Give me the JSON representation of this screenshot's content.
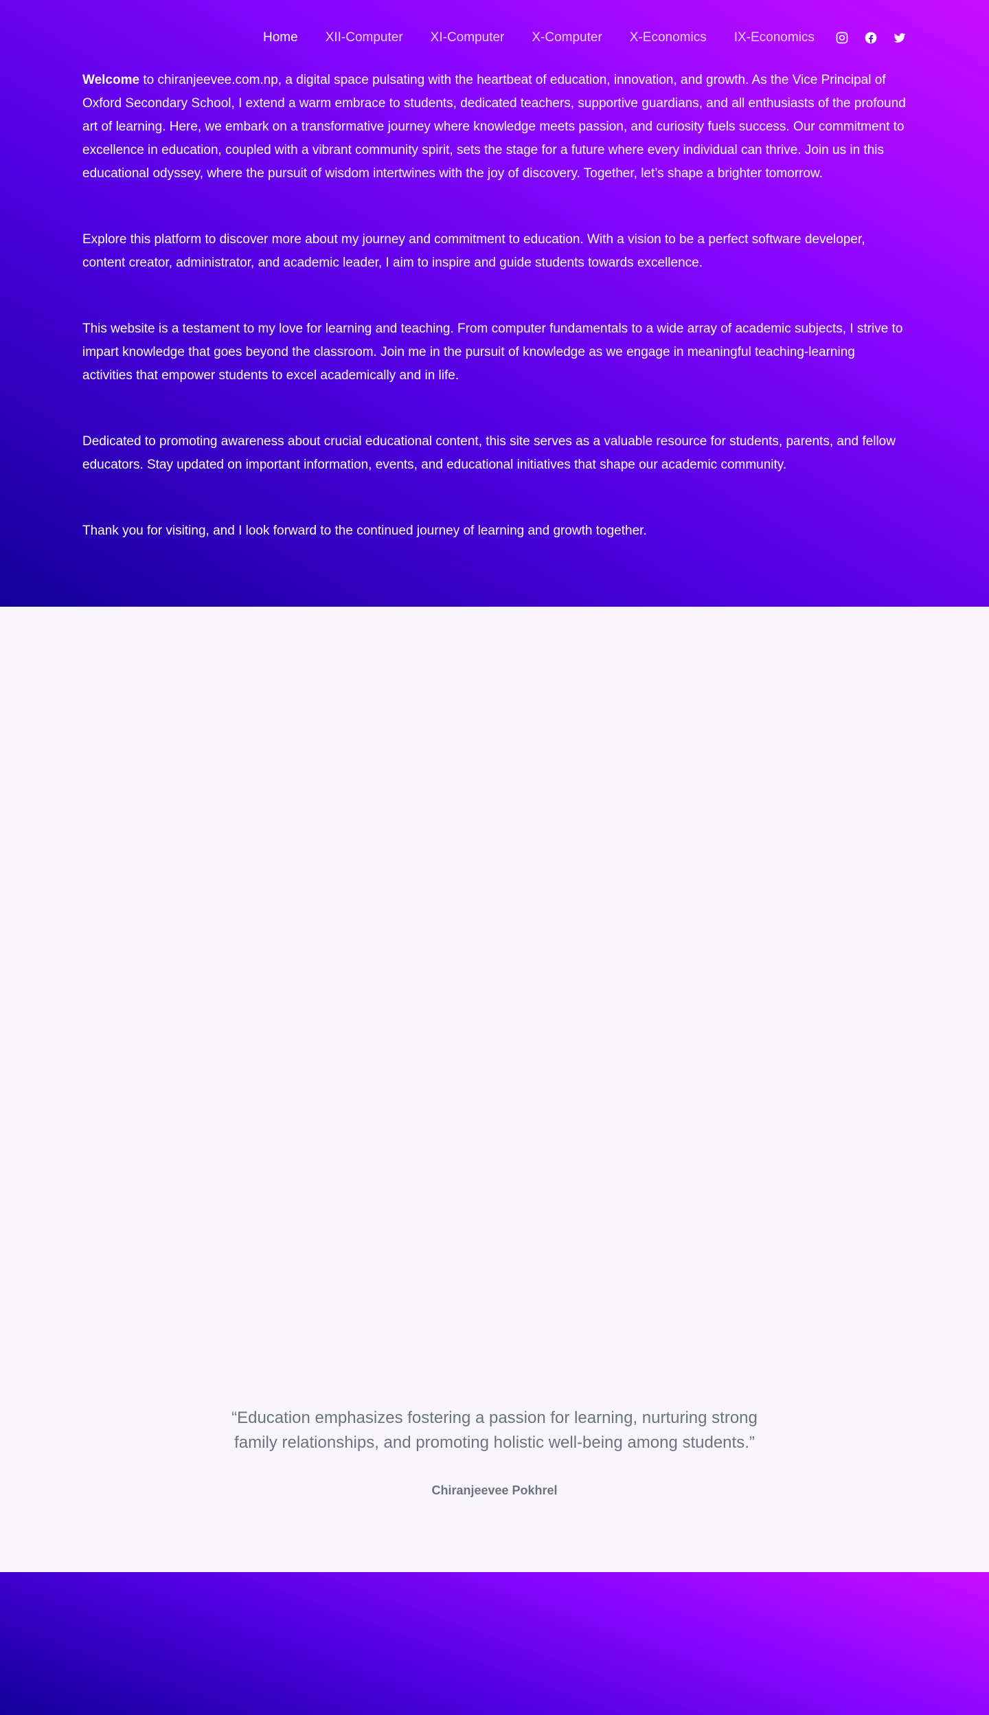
{
  "nav": {
    "items": [
      {
        "label": "Home",
        "active": true
      },
      {
        "label": "XII-Computer",
        "active": false
      },
      {
        "label": "XI-Computer",
        "active": false
      },
      {
        "label": "X-Computer",
        "active": false
      },
      {
        "label": "X-Economics",
        "active": false
      },
      {
        "label": "IX-Economics",
        "active": false
      }
    ],
    "social": [
      "instagram-icon",
      "facebook-icon",
      "twitter-icon"
    ]
  },
  "intro": {
    "welcome_bold": "Welcome",
    "p1_rest": " to chiranjeevee.com.np, a digital space pulsating with the heartbeat of education, innovation, and growth. As the Vice Principal of Oxford Secondary School, I extend a warm embrace to students, dedicated teachers, supportive guardians, and all enthusiasts of the profound art of learning. Here, we embark on a transformative journey where knowledge meets passion, and curiosity fuels success. Our commitment to excellence in education, coupled with a vibrant community spirit, sets the stage for a future where every individual can thrive. Join us in this educational odyssey, where the pursuit of wisdom intertwines with the joy of discovery. Together, let’s shape a brighter tomorrow.",
    "p2": "Explore this platform to discover more about my journey and commitment to education. With a vision to be a perfect software developer, content creator, administrator, and academic leader, I aim to inspire and guide students towards excellence.",
    "p3": "This website is a testament to my love for learning and teaching. From computer fundamentals to a wide array of academic subjects, I strive to impart knowledge that goes beyond the classroom. Join me in the pursuit of knowledge as we engage in meaningful teaching-learning activities that empower students to excel academically and in life.",
    "p4": "Dedicated to promoting awareness about crucial educational content, this site serves as a valuable resource for students, parents, and fellow educators. Stay updated on important information, events, and educational initiatives that shape our academic community.",
    "p5": "Thank you for visiting, and I look forward to the continued journey of learning and growth together."
  },
  "quote": {
    "text": "“Education emphasizes fostering a passion for learning, nurturing strong family relationships, and promoting holistic well-being among students.”",
    "author": "Chiranjeevee Pokhrel"
  },
  "colors": {
    "gradient_dark": "#12009a",
    "gradient_mid": "#8a06ff",
    "gradient_light": "#c80dff",
    "page_bg": "#f8f6fc",
    "quote_text": "#6b7280"
  }
}
